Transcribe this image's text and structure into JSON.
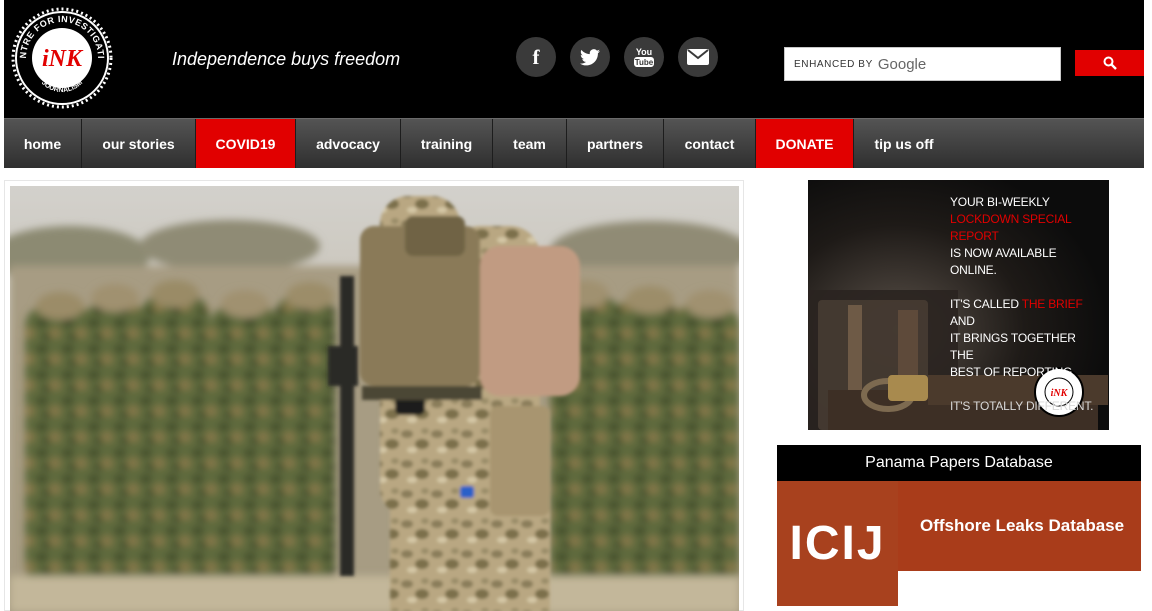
{
  "header": {
    "logo_text": "CENTRE FOR INVESTIGATIVE JOURNALISM",
    "logo_initials": "INK",
    "tagline": "Independence buys freedom",
    "social": [
      {
        "name": "facebook",
        "icon": "facebook-icon"
      },
      {
        "name": "twitter",
        "icon": "twitter-icon"
      },
      {
        "name": "youtube",
        "icon": "youtube-icon",
        "label": "You Tube"
      },
      {
        "name": "email",
        "icon": "envelope-icon"
      }
    ],
    "search": {
      "label": "ENHANCED BY",
      "brand": "Google",
      "button_icon": "search-icon"
    }
  },
  "nav": {
    "items": [
      {
        "label": "home",
        "highlight": false
      },
      {
        "label": "our stories",
        "highlight": false
      },
      {
        "label": "COVID19",
        "highlight": true
      },
      {
        "label": "advocacy",
        "highlight": false
      },
      {
        "label": "training",
        "highlight": false
      },
      {
        "label": "team",
        "highlight": false
      },
      {
        "label": "partners",
        "highlight": false
      },
      {
        "label": "contact",
        "highlight": false
      },
      {
        "label": "DONATE",
        "highlight": true
      },
      {
        "label": "tip us off",
        "highlight": false
      }
    ]
  },
  "promo": {
    "line1": "YOUR BI-WEEKLY",
    "line2": "LOCKDOWN SPECIAL REPORT",
    "line3": "IS NOW AVAILABLE ONLINE.",
    "line4a": "IT'S CALLED ",
    "line4b": "THE BRIEF",
    "line4c": " AND",
    "line5": "IT BRINGS TOGETHER THE",
    "line6": "BEST OF REPORTING.",
    "line7": "IT'S TOTALLY DIFFERENT."
  },
  "panama": {
    "title": "Panama Papers Database",
    "logo": "ICIJ",
    "banner_text": "Offshore Leaks Database"
  },
  "colors": {
    "accent": "#e10000",
    "header_bg": "#000000",
    "nav_bg": "#3a3a3a",
    "icij_brown": "#a8411e"
  }
}
